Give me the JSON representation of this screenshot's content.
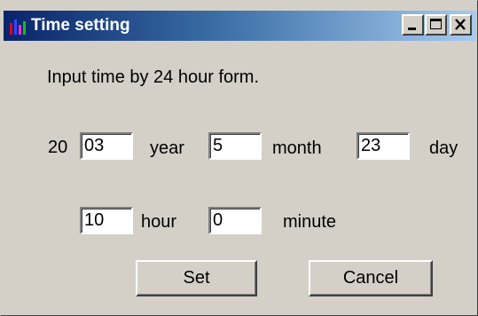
{
  "window": {
    "title": "Time setting",
    "title_gradient_start": "#0a246a",
    "title_gradient_end": "#a6caf0",
    "background": "#d4d0c8",
    "app_icon": "bar-chart-icon",
    "caption_buttons": [
      "minimize-icon",
      "maximize-icon",
      "close-icon"
    ]
  },
  "instruction": "Input time by 24 hour form.",
  "date": {
    "century_prefix": "20",
    "year_value": "03",
    "year_label": "year",
    "month_value": "5",
    "month_label": "month",
    "day_value": "23",
    "day_label": "day"
  },
  "time": {
    "hour_value": "10",
    "hour_label": "hour",
    "minute_value": "0",
    "minute_label": "minute"
  },
  "buttons": {
    "set_label": "Set",
    "cancel_label": "Cancel"
  }
}
